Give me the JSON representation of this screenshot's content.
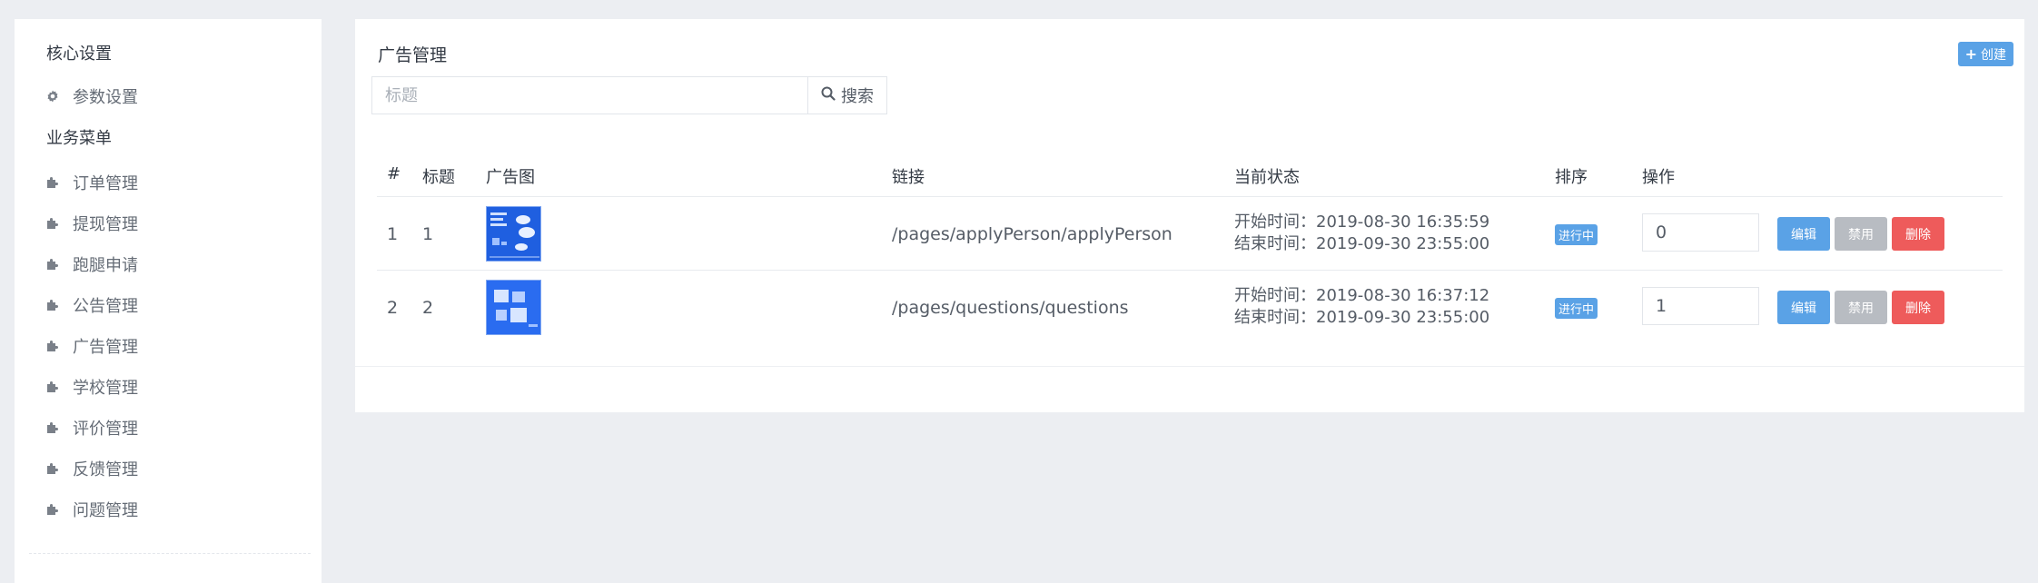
{
  "sidebar": {
    "sections": [
      {
        "title": "核心设置",
        "items": [
          {
            "label": "参数设置",
            "icon": "gear-icon"
          }
        ]
      },
      {
        "title": "业务菜单",
        "items": [
          {
            "label": "订单管理",
            "icon": "puzzle-icon"
          },
          {
            "label": "提现管理",
            "icon": "puzzle-icon"
          },
          {
            "label": "跑腿申请",
            "icon": "puzzle-icon"
          },
          {
            "label": "公告管理",
            "icon": "puzzle-icon"
          },
          {
            "label": "广告管理",
            "icon": "puzzle-icon"
          },
          {
            "label": "学校管理",
            "icon": "puzzle-icon"
          },
          {
            "label": "评价管理",
            "icon": "puzzle-icon"
          },
          {
            "label": "反馈管理",
            "icon": "puzzle-icon"
          },
          {
            "label": "问题管理",
            "icon": "puzzle-icon"
          }
        ]
      }
    ]
  },
  "main": {
    "title": "广告管理",
    "create_label": "创建",
    "search": {
      "placeholder": "标题",
      "button_label": "搜索"
    },
    "table": {
      "columns": [
        "#",
        "标题",
        "广告图",
        "链接",
        "当前状态",
        "排序",
        "操作"
      ],
      "rows": [
        {
          "id": "1",
          "title": "1",
          "link": "/pages/applyPerson/applyPerson",
          "start": "开始时间：2019-08-30 16:35:59",
          "end": "结束时间：2019-09-30 23:55:00",
          "status": "进行中",
          "sort": "0"
        },
        {
          "id": "2",
          "title": "2",
          "link": "/pages/questions/questions",
          "start": "开始时间：2019-08-30 16:37:12",
          "end": "结束时间：2019-09-30 23:55:00",
          "status": "进行中",
          "sort": "1"
        }
      ],
      "actions": {
        "edit": "编辑",
        "disable": "禁用",
        "delete": "删除"
      }
    }
  },
  "colors": {
    "primary": "#5aa2e6",
    "danger": "#ee5b5b",
    "muted": "#b8bcc2",
    "background": "#eceef2"
  }
}
